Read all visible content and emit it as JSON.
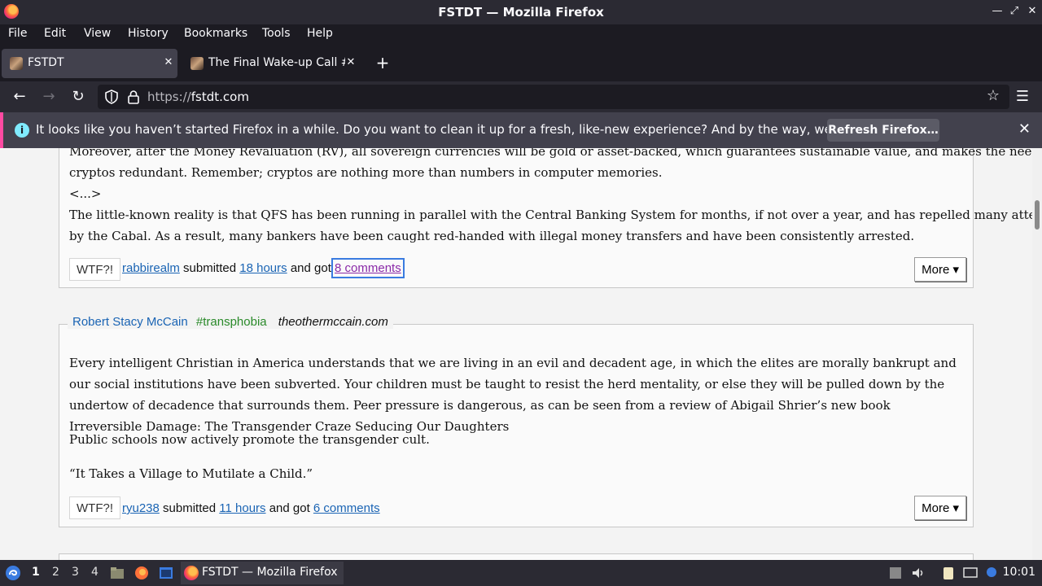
{
  "window": {
    "title": "FSTDT — Mozilla Firefox"
  },
  "menu": [
    "File",
    "Edit",
    "View",
    "History",
    "Bookmarks",
    "Tools",
    "Help"
  ],
  "tabs": [
    {
      "label": "FSTDT",
      "active": true
    },
    {
      "label": "The Final Wake-up Call #",
      "active": false
    }
  ],
  "nav": {
    "url_prefix": "https://",
    "url_host": "fstdt.com"
  },
  "notification": {
    "message": "It looks like you haven’t started Firefox in a while. Do you want to clean it up for a fresh, like-new experience? And by the way, welcome back!",
    "button": "Refresh Firefox…"
  },
  "post1": {
    "text_lines": [
      "Moreover, after the Money Revaluation (RV), all sovereign currencies will be gold or asset-backed, which guarantees sustainable value, and makes the need for unbacked",
      "cryptos redundant. Remember; cryptos are nothing more than numbers in computer memories.",
      "<...>",
      "The little-known reality is that QFS has been running in parallel with the Central Banking System for months, if not over a year, and has repelled many attempts at hacking",
      "by the Cabal. As a result, many bankers have been caught red-handed with illegal money transfers and have been consistently arrested."
    ],
    "wtf": "WTF?!",
    "user": "rabbirealm",
    "submitted": "submitted",
    "time": "18 hours",
    "and_got": "and got",
    "comments": "8 comments",
    "more": "More ▾"
  },
  "post2": {
    "author": "Robert Stacy McCain",
    "tag": "#transphobia",
    "source": "theothermccain.com",
    "para1": "Every intelligent Christian in America understands that we are living in an evil and decadent age, in which the elites are morally bankrupt and our social institutions have been subverted. Your children must be taught to resist the herd mentality, or else they will be pulled down by the undertow of decadence that surrounds them. Peer pressure is dangerous, as can be seen from a review of Abigail Shrier’s new book Irreversible Damage: The Transgender Craze Seducing Our Daughters",
    "para2": "Public schools now actively promote the transgender cult.",
    "para3": "“It Takes a Village to Mutilate a Child.”",
    "wtf": "WTF?!",
    "user": "ryu238",
    "submitted": "submitted",
    "time": "11 hours",
    "and_got": "and got",
    "comments": "6 comments",
    "more": "More ▾"
  },
  "taskbar": {
    "workspaces": [
      "1",
      "2",
      "3",
      "4"
    ],
    "task_label": "FSTDT — Mozilla Firefox",
    "clock": "10:01"
  }
}
